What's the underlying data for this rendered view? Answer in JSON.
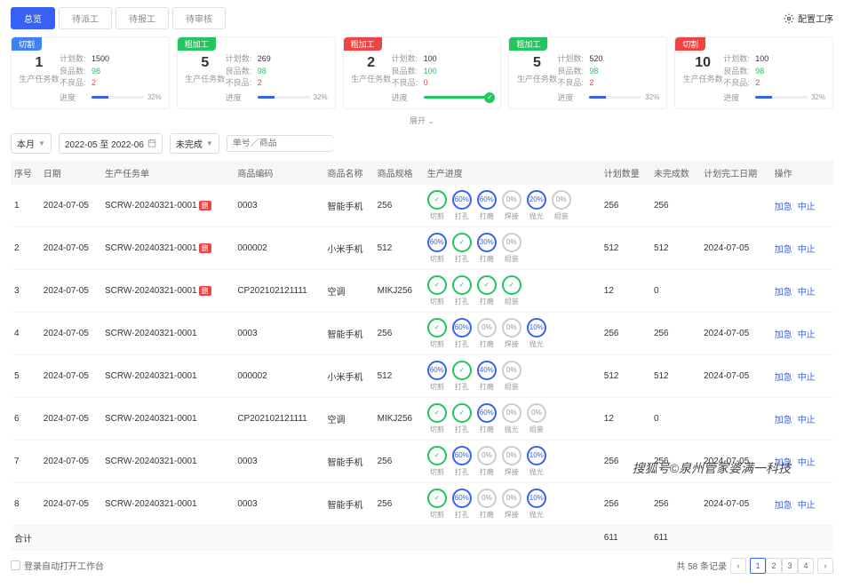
{
  "tabs": [
    "总览",
    "待派工",
    "待报工",
    "待审核"
  ],
  "config_label": "配置工序",
  "cards": [
    {
      "tag": "切割",
      "tagClass": "tag-blue",
      "num": "1",
      "label": "生产任务数",
      "plan": "1500",
      "good": "98",
      "bad": "2",
      "pct": "32%",
      "pctW": "32%"
    },
    {
      "tag": "粗加工",
      "tagClass": "tag-green",
      "num": "5",
      "label": "生产任务数",
      "plan": "269",
      "good": "98",
      "bad": "2",
      "pct": "32%",
      "pctW": "32%"
    },
    {
      "tag": "粗加工",
      "tagClass": "tag-red",
      "num": "2",
      "label": "生产任务数",
      "plan": "100",
      "good": "100",
      "bad": "0",
      "pct": "",
      "pctW": "100%",
      "done": true
    },
    {
      "tag": "粗加工",
      "tagClass": "tag-green",
      "num": "5",
      "label": "生产任务数",
      "plan": "520",
      "good": "98",
      "bad": "2",
      "pct": "32%",
      "pctW": "32%"
    },
    {
      "tag": "切割",
      "tagClass": "tag-red",
      "num": "10",
      "label": "生产任务数",
      "plan": "100",
      "good": "98",
      "bad": "2",
      "pct": "32%",
      "pctW": "32%"
    }
  ],
  "stat_labels": {
    "plan": "计划数:",
    "good": "良品数:",
    "bad": "不良品:",
    "prog": "进度"
  },
  "expand": "展开 ⌄",
  "filters": {
    "month": "本月",
    "range": "2022-05 至 2022-06",
    "status": "未完成",
    "search_ph": "单号／商品"
  },
  "headers": [
    "序号",
    "日期",
    "生产任务单",
    "商品编码",
    "商品名称",
    "商品规格",
    "生产进度",
    "计划数量",
    "未完成数",
    "计划完工日期",
    "操作"
  ],
  "rows": [
    {
      "idx": "1",
      "date": "2024-07-05",
      "task": "SCRW-20240321-0001",
      "badge": "删",
      "code": "0003",
      "name": "智能手机",
      "spec": "256",
      "steps": [
        {
          "v": "✓",
          "c": "green",
          "l": "切割"
        },
        {
          "v": "60%",
          "c": "blue",
          "l": "打孔"
        },
        {
          "v": "60%",
          "c": "blue",
          "l": "打磨"
        },
        {
          "v": "0%",
          "c": "gray",
          "l": "焊接"
        },
        {
          "v": "20%",
          "c": "blue",
          "l": "抛光"
        },
        {
          "v": "0%",
          "c": "gray",
          "l": "组装"
        }
      ],
      "plan": "256",
      "remain": "256",
      "due": ""
    },
    {
      "idx": "2",
      "date": "2024-07-05",
      "task": "SCRW-20240321-0001",
      "badge": "删",
      "code": "000002",
      "name": "小米手机",
      "spec": "512",
      "steps": [
        {
          "v": "60%",
          "c": "blue",
          "l": "切割"
        },
        {
          "v": "✓",
          "c": "green",
          "l": "打孔"
        },
        {
          "v": "30%",
          "c": "blue",
          "l": "打磨"
        },
        {
          "v": "0%",
          "c": "gray",
          "l": "组装"
        }
      ],
      "plan": "512",
      "remain": "512",
      "due": "2024-07-05"
    },
    {
      "idx": "3",
      "date": "2024-07-05",
      "task": "SCRW-20240321-0001",
      "badge": "删",
      "code": "CP202102121111",
      "name": "空调",
      "spec": "MIKJ256",
      "steps": [
        {
          "v": "✓",
          "c": "green",
          "l": "切割"
        },
        {
          "v": "✓",
          "c": "green",
          "l": "打孔"
        },
        {
          "v": "✓",
          "c": "green",
          "l": "打磨"
        },
        {
          "v": "✓",
          "c": "green",
          "l": "组装"
        }
      ],
      "plan": "12",
      "remain": "0",
      "due": ""
    },
    {
      "idx": "4",
      "date": "2024-07-05",
      "task": "SCRW-20240321-0001",
      "badge": "",
      "code": "0003",
      "name": "智能手机",
      "spec": "256",
      "steps": [
        {
          "v": "✓",
          "c": "green",
          "l": "切割"
        },
        {
          "v": "60%",
          "c": "blue",
          "l": "打孔"
        },
        {
          "v": "0%",
          "c": "gray",
          "l": "打磨"
        },
        {
          "v": "0%",
          "c": "gray",
          "l": "焊接"
        },
        {
          "v": "10%",
          "c": "blue",
          "l": "抛光"
        }
      ],
      "plan": "256",
      "remain": "256",
      "due": "2024-07-05"
    },
    {
      "idx": "5",
      "date": "2024-07-05",
      "task": "SCRW-20240321-0001",
      "badge": "",
      "code": "000002",
      "name": "小米手机",
      "spec": "512",
      "steps": [
        {
          "v": "60%",
          "c": "blue",
          "l": "切割"
        },
        {
          "v": "✓",
          "c": "green",
          "l": "打孔"
        },
        {
          "v": "40%",
          "c": "blue",
          "l": "打磨"
        },
        {
          "v": "0%",
          "c": "gray",
          "l": "组装"
        }
      ],
      "plan": "512",
      "remain": "512",
      "due": "2024-07-05"
    },
    {
      "idx": "6",
      "date": "2024-07-05",
      "task": "SCRW-20240321-0001",
      "badge": "",
      "code": "CP202102121111",
      "name": "空调",
      "spec": "MIKJ256",
      "steps": [
        {
          "v": "✓",
          "c": "green",
          "l": "切割"
        },
        {
          "v": "✓",
          "c": "green",
          "l": "打孔"
        },
        {
          "v": "60%",
          "c": "blue",
          "l": "打磨"
        },
        {
          "v": "0%",
          "c": "gray",
          "l": "抛光"
        },
        {
          "v": "0%",
          "c": "gray",
          "l": "组装"
        }
      ],
      "plan": "12",
      "remain": "0",
      "due": ""
    },
    {
      "idx": "7",
      "date": "2024-07-05",
      "task": "SCRW-20240321-0001",
      "badge": "",
      "code": "0003",
      "name": "智能手机",
      "spec": "256",
      "steps": [
        {
          "v": "✓",
          "c": "green",
          "l": "切割"
        },
        {
          "v": "60%",
          "c": "blue",
          "l": "打孔"
        },
        {
          "v": "0%",
          "c": "gray",
          "l": "打磨"
        },
        {
          "v": "0%",
          "c": "gray",
          "l": "焊接"
        },
        {
          "v": "10%",
          "c": "blue",
          "l": "抛光"
        }
      ],
      "plan": "256",
      "remain": "256",
      "due": "2024-07-05"
    },
    {
      "idx": "8",
      "date": "2024-07-05",
      "task": "SCRW-20240321-0001",
      "badge": "",
      "code": "0003",
      "name": "智能手机",
      "spec": "256",
      "steps": [
        {
          "v": "✓",
          "c": "green",
          "l": "切割"
        },
        {
          "v": "60%",
          "c": "blue",
          "l": "打孔"
        },
        {
          "v": "0%",
          "c": "gray",
          "l": "打磨"
        },
        {
          "v": "0%",
          "c": "gray",
          "l": "焊接"
        },
        {
          "v": "10%",
          "c": "blue",
          "l": "抛光"
        }
      ],
      "plan": "256",
      "remain": "256",
      "due": "2024-07-05"
    }
  ],
  "total": {
    "label": "合计",
    "plan": "611",
    "remain": "611"
  },
  "actions": {
    "urgent": "加急",
    "stop": "中止"
  },
  "bottom": {
    "checkbox": "登录自动打开工作台",
    "total": "共 58 条记录",
    "pages": [
      "1",
      "2",
      "3",
      "4"
    ]
  },
  "watermark": "搜狐号©泉州管家婆满一科技"
}
